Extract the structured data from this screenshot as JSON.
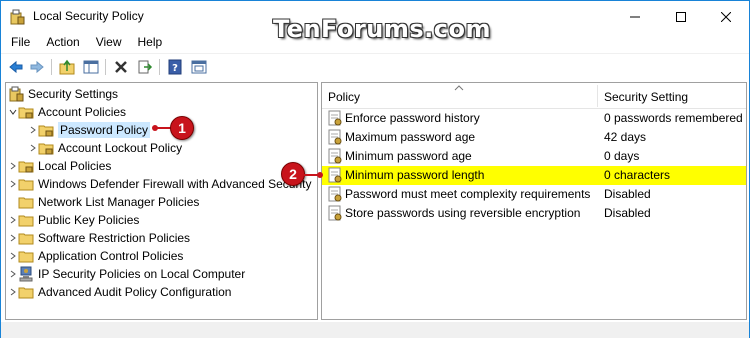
{
  "window": {
    "title": "Local Security Policy",
    "watermark": "TenForums.com",
    "colors": {
      "accent": "#1883d7",
      "highlight": "#ffff00",
      "selection": "#cce8ff",
      "callout": "#c8141c"
    }
  },
  "menu": [
    "File",
    "Action",
    "View",
    "Help"
  ],
  "toolbar": {
    "buttons": [
      "back-icon",
      "forward-icon",
      "up-folder-icon",
      "show-hide-tree-icon",
      "delete-icon",
      "export-list-icon",
      "help-icon",
      "properties-icon"
    ]
  },
  "tree": {
    "root": "Security Settings",
    "items": [
      {
        "label": "Account Policies",
        "icon": "folder-lock-icon",
        "expanded": true
      },
      {
        "label": "Password Policy",
        "icon": "folder-lock-icon",
        "selected": true
      },
      {
        "label": "Account Lockout Policy",
        "icon": "folder-lock-icon"
      },
      {
        "label": "Local Policies",
        "icon": "folder-lock-icon"
      },
      {
        "label": "Windows Defender Firewall with Advanced Security",
        "icon": "folder-icon"
      },
      {
        "label": "Network List Manager Policies",
        "icon": "folder-icon"
      },
      {
        "label": "Public Key Policies",
        "icon": "folder-icon"
      },
      {
        "label": "Software Restriction Policies",
        "icon": "folder-icon"
      },
      {
        "label": "Application Control Policies",
        "icon": "folder-icon"
      },
      {
        "label": "IP Security Policies on Local Computer",
        "icon": "ipsec-icon"
      },
      {
        "label": "Advanced Audit Policy Configuration",
        "icon": "folder-icon"
      }
    ]
  },
  "list": {
    "columns": [
      "Policy",
      "Security Setting"
    ],
    "rows": [
      {
        "policy": "Enforce password history",
        "setting": "0 passwords remembered"
      },
      {
        "policy": "Maximum password age",
        "setting": "42 days"
      },
      {
        "policy": "Minimum password age",
        "setting": "0 days"
      },
      {
        "policy": "Minimum password length",
        "setting": "0 characters",
        "highlighted": true
      },
      {
        "policy": "Password must meet complexity requirements",
        "setting": "Disabled"
      },
      {
        "policy": "Store passwords using reversible encryption",
        "setting": "Disabled"
      }
    ]
  },
  "callouts": [
    "1",
    "2"
  ]
}
